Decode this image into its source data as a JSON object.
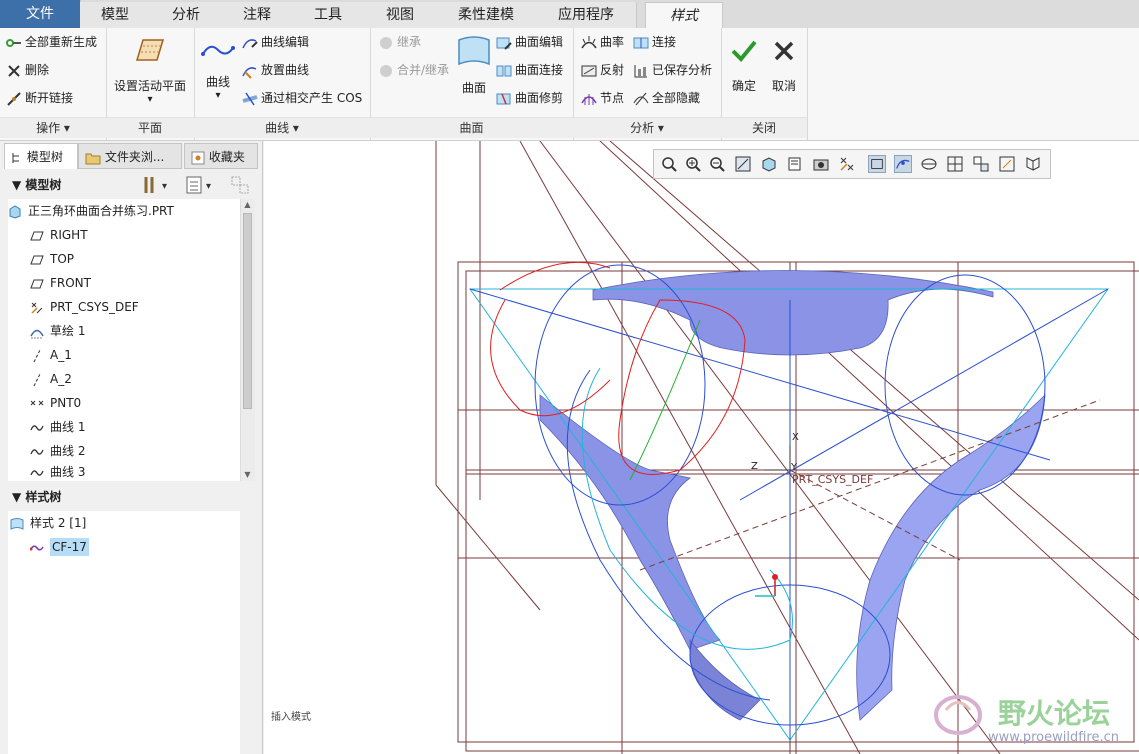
{
  "menu": {
    "tabs": [
      "文件",
      "模型",
      "分析",
      "注释",
      "工具",
      "视图",
      "柔性建模",
      "应用程序",
      "样式"
    ],
    "active": "样式"
  },
  "ribbon": {
    "operations": {
      "label": "操作",
      "items": [
        "全部重新生成",
        "删除",
        "断开链接"
      ]
    },
    "plane": {
      "label": "平面",
      "set_active_plane": "设置活动平面"
    },
    "curves": {
      "label": "曲线",
      "curve": "曲线",
      "items": [
        "曲线编辑",
        "放置曲线",
        "通过相交产生 COS"
      ]
    },
    "surfaces": {
      "label": "曲面",
      "inherit": "继承",
      "merge_inherit": "合并/继承",
      "surface": "曲面",
      "items": [
        "曲面编辑",
        "曲面连接",
        "曲面修剪"
      ]
    },
    "analysis": {
      "label": "分析",
      "items": [
        "曲率",
        "反射",
        "节点"
      ],
      "items2": [
        "连接",
        "已保存分析",
        "全部隐藏"
      ]
    },
    "close": {
      "label": "关闭",
      "ok": "确定",
      "cancel": "取消"
    }
  },
  "left_panel": {
    "tabs": [
      "模型树",
      "文件夹浏...",
      "收藏夹"
    ],
    "model_tree_header": "模型树",
    "model_tree": [
      "正三角环曲面合并练习.PRT",
      "RIGHT",
      "TOP",
      "FRONT",
      "PRT_CSYS_DEF",
      "草绘 1",
      "A_1",
      "A_2",
      "PNT0",
      "曲线 1",
      "曲线 2",
      "曲线 3"
    ],
    "style_tree_header": "样式树",
    "style_tree": [
      "样式 2 [1]",
      "CF-17"
    ]
  },
  "viewport": {
    "csys_label": "PRT_CSYS_DEF",
    "axis_x": "X",
    "axis_y": "Y",
    "axis_z": "Z",
    "status": "插入模式",
    "watermark_title": "野火论坛",
    "watermark_url": "www.proewildfire.cn"
  },
  "colors": {
    "file_tab": "#3d6fa8",
    "surface": "#8a93e6",
    "curve_blue": "#2a4fd0",
    "curve_cyan": "#22b5d8",
    "datum": "#7a3b3b",
    "sketch_red": "#e02020"
  }
}
